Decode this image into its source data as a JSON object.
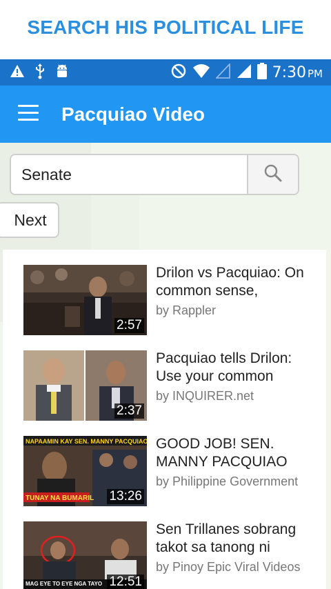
{
  "banner": {
    "text": "SEARCH HIS POLITICAL LIFE"
  },
  "status_bar": {
    "time": "7:30",
    "ampm": "PM",
    "icons": [
      "warning-icon",
      "usb-icon",
      "android-debug-icon",
      "do-not-disturb-icon",
      "wifi-icon",
      "signal-empty-icon",
      "signal-full-icon",
      "battery-icon"
    ]
  },
  "app_bar": {
    "title": "Pacquiao Video",
    "menu_icon": "hamburger-menu-icon"
  },
  "search": {
    "value": "Senate",
    "placeholder": "",
    "button_icon": "search-icon"
  },
  "pagination": {
    "next_label": "Next"
  },
  "videos": [
    {
      "title": "Drilon vs Pacquiao: On common sense,",
      "author": "by Rappler",
      "duration": "2:57"
    },
    {
      "title": "Pacquiao tells Drilon: Use your common",
      "author": "by INQUIRER.net",
      "duration": "2:37"
    },
    {
      "title": "GOOD JOB! SEN. MANNY PACQUIAO",
      "author": "by Philippine Government",
      "duration": "13:26",
      "thumb_top_text": "NAPAAMIN KAY SEN. MANNY PACQUIAO",
      "thumb_bottom_text": "TUNAY NA BUMARIL"
    },
    {
      "title": "Sen Trillanes sobrang takot sa tanong ni",
      "author": "by Pinoy Epic Viral Videos",
      "duration": "12:51",
      "thumb_bottom_text": "MAG EYE TO EYE NGA TAYO"
    }
  ],
  "colors": {
    "banner_text": "#2b8fe0",
    "status_bar": "#1a73c9",
    "app_bar": "#2196f3",
    "content_bg": "#f1f6ec"
  }
}
